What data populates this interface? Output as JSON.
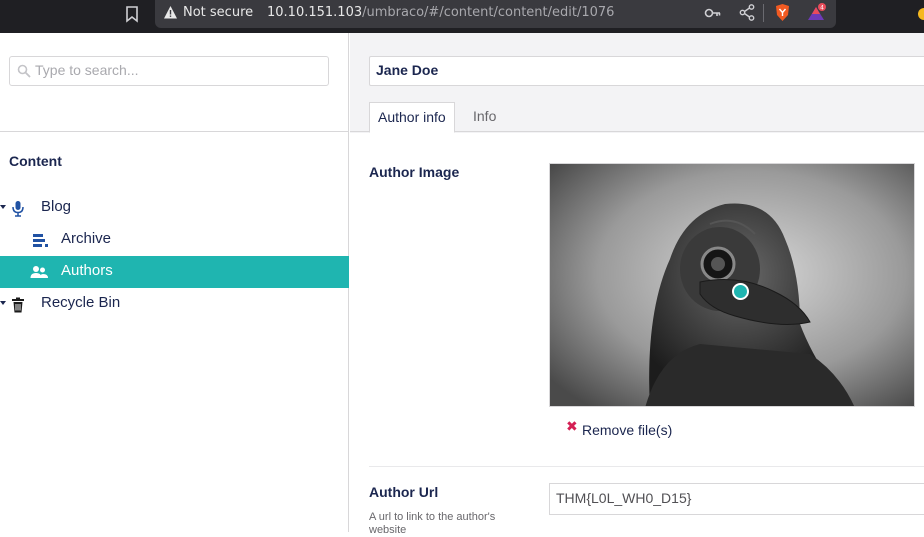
{
  "browser": {
    "security_label": "Not secure",
    "url_host": "10.10.151.103",
    "url_path": "/umbraco/#/content/content/edit/1076",
    "notification_count": "4"
  },
  "sidebar": {
    "search_placeholder": "Type to search...",
    "section_title": "Content",
    "items": [
      {
        "label": "Blog",
        "icon": "microphone-icon",
        "active": false
      },
      {
        "label": "Archive",
        "icon": "archive-list-icon",
        "active": false
      },
      {
        "label": "Authors",
        "icon": "users-icon",
        "active": true
      },
      {
        "label": "Recycle Bin",
        "icon": "trash-icon",
        "active": false
      }
    ]
  },
  "editor": {
    "node_name": "Jane Doe",
    "tabs": [
      {
        "label": "Author info",
        "active": true
      },
      {
        "label": "Info",
        "active": false
      }
    ],
    "properties": {
      "author_image_label": "Author Image",
      "remove_files_label": "Remove file(s)",
      "author_url_label": "Author Url",
      "author_url_desc": "A url to link to the author's website",
      "author_url_value": "THM{L0L_WH0_D15}"
    }
  },
  "colors": {
    "accent": "#1fb5b0",
    "text_primary": "#1b264f",
    "remove_red": "#d42054"
  }
}
